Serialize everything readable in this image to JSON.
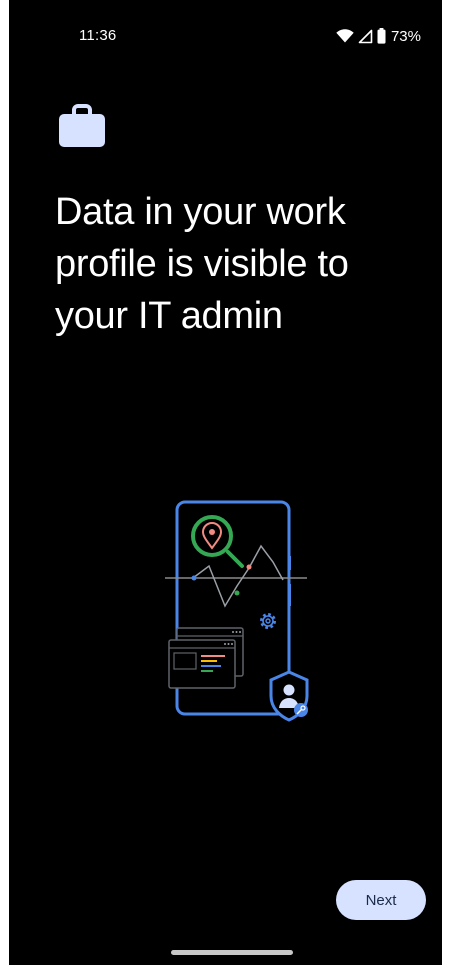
{
  "status_bar": {
    "time": "11:36",
    "battery_percent": "73%",
    "icons": [
      "wifi-icon",
      "cellular-signal-icon",
      "battery-icon"
    ]
  },
  "header": {
    "icon": "briefcase-icon"
  },
  "main": {
    "title": "Data in your work profile is visible to your IT admin"
  },
  "illustration": {
    "icons": [
      "phone-icon",
      "location-pin-magnifier-icon",
      "gear-icon",
      "browser-window-icon",
      "shield-user-icon",
      "key-icon"
    ]
  },
  "footer": {
    "next_label": "Next"
  },
  "colors": {
    "background": "#000000",
    "text": "#ffffff",
    "accent_button": "#d6e2ff",
    "briefcase": "#d6e2ff",
    "phone_outline": "#4a86e8",
    "magnifier": "#34a853",
    "pin": "#f28b82",
    "home_indicator": "#c7c7c7"
  }
}
